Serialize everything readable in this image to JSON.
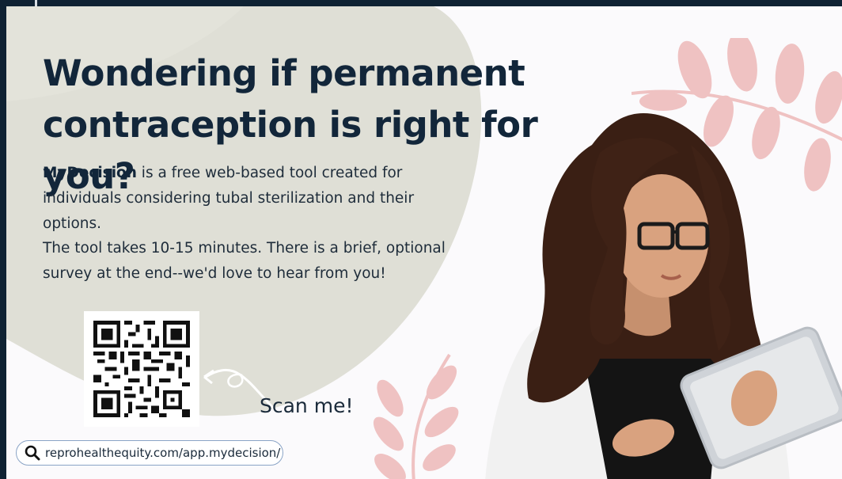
{
  "headline": {
    "line1": "Wondering if permanent",
    "line2": "contraception is right for you?"
  },
  "intro": {
    "brand": "MyDecision",
    "rest": " is a free web-based tool created for individuals considering tubal sterilization and their options."
  },
  "details": "The tool takes 10-15 minutes. There is a brief, optional survey at the end--we'd love to hear from you!",
  "qr": {
    "icon": "qr-code"
  },
  "scan_label": "Scan me!",
  "url": {
    "icon": "search-icon",
    "text": "reprohealthequity.com/app.mydecision/"
  },
  "colors": {
    "background_frame": "#0f2233",
    "page": "#fbfafc",
    "blob": "#dcdcd2",
    "leaf": "#efc2c2",
    "headline": "#12263a",
    "pill_border": "#8aa4c6"
  }
}
